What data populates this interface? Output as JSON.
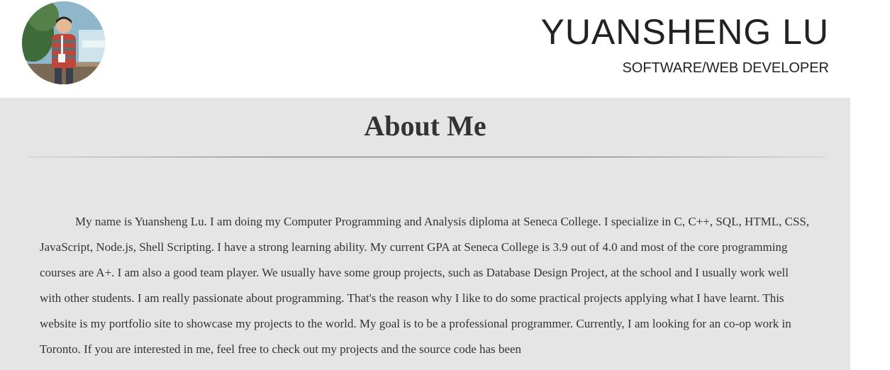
{
  "header": {
    "name": "YUANSHENG LU",
    "role": "SOFTWARE/WEB DEVELOPER"
  },
  "avatar": {
    "icon": "profile-photo"
  },
  "about": {
    "title": "About Me",
    "paragraph": "My name is Yuansheng Lu. I am doing my Computer Programming and Analysis diploma at Seneca College. I specialize in C, C++, SQL, HTML, CSS, JavaScript, Node.js, Shell Scripting. I have a strong learning ability. My current GPA at Seneca College is 3.9 out of 4.0 and most of the core programming courses are A+. I am also a good team player. We usually have some group projects, such as Database Design Project, at the school and I usually work well with other students. I am really passionate about programming. That's the reason why I like to do some practical projects applying what I have learnt. This website is my portfolio site to showcase my projects to the world. My goal is to be a professional programmer. Currently, I am looking for an co-op work in Toronto. If you are interested in me, feel free to check out my projects and the source code has been"
  },
  "colors": {
    "section_background": "#e5e5e5",
    "text": "#333333",
    "header_background": "#ffffff"
  }
}
